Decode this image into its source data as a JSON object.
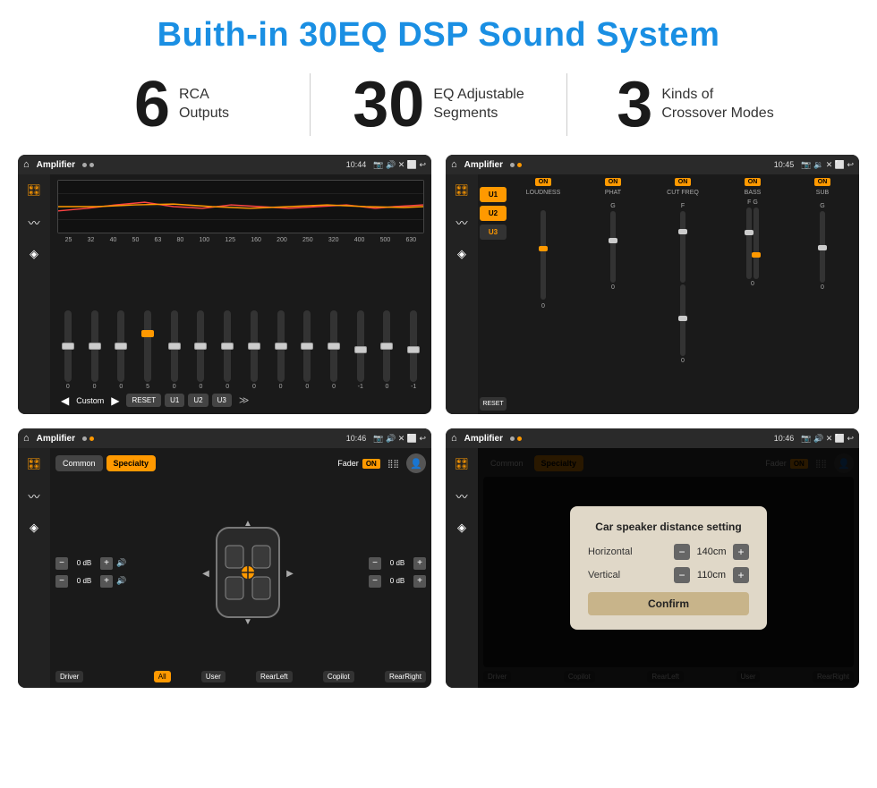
{
  "title": "Buith-in 30EQ DSP Sound System",
  "stats": [
    {
      "number": "6",
      "label": "RCA\nOutputs"
    },
    {
      "number": "30",
      "label": "EQ Adjustable\nSegments"
    },
    {
      "number": "3",
      "label": "Kinds of\nCrossover Modes"
    }
  ],
  "screen1": {
    "appName": "Amplifier",
    "time": "10:44",
    "eq_freqs": [
      "25",
      "32",
      "40",
      "50",
      "63",
      "80",
      "100",
      "125",
      "160",
      "200",
      "250",
      "320",
      "400",
      "500",
      "630"
    ],
    "eq_values": [
      "0",
      "0",
      "0",
      "5",
      "0",
      "0",
      "0",
      "0",
      "0",
      "0",
      "0",
      "-1",
      "0",
      "-1"
    ],
    "preset": "Custom",
    "buttons": [
      "RESET",
      "U1",
      "U2",
      "U3"
    ]
  },
  "screen2": {
    "appName": "Amplifier",
    "time": "10:45",
    "channels": [
      "LOUDNESS",
      "PHAT",
      "CUT FREQ",
      "BASS",
      "SUB"
    ],
    "u_buttons": [
      "U1",
      "U2",
      "U3"
    ],
    "reset_label": "RESET"
  },
  "screen3": {
    "appName": "Amplifier",
    "time": "10:46",
    "tabs": [
      "Common",
      "Specialty"
    ],
    "fader_label": "Fader",
    "on_label": "ON",
    "db_values": [
      "0 dB",
      "0 dB",
      "0 dB",
      "0 dB"
    ],
    "bottom_labels": [
      "Driver",
      "All",
      "User",
      "RearLeft",
      "Copilot",
      "RearRight"
    ]
  },
  "screen4": {
    "appName": "Amplifier",
    "time": "10:46",
    "tabs": [
      "Common",
      "Specialty"
    ],
    "on_label": "ON",
    "dialog": {
      "title": "Car speaker distance setting",
      "horizontal_label": "Horizontal",
      "horizontal_value": "140cm",
      "vertical_label": "Vertical",
      "vertical_value": "110cm",
      "confirm_label": "Confirm"
    },
    "bottom_labels": [
      "Driver",
      "Copilot",
      "RearLeft",
      "User",
      "RearRight"
    ]
  }
}
